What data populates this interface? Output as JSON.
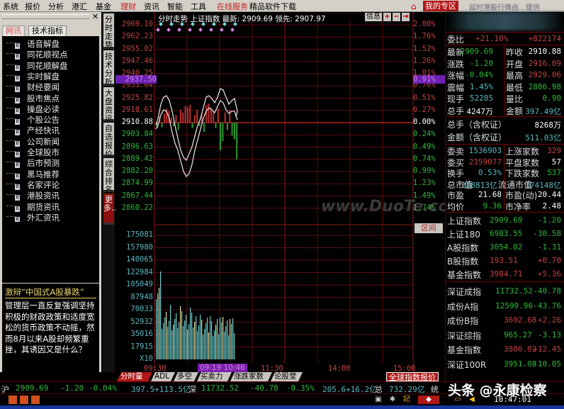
{
  "menu": [
    "系统",
    "报价",
    "分析",
    "港汇",
    "基金",
    "理财",
    "资讯",
    "智能",
    "工具",
    "在线服务",
    "精品软件下载"
  ],
  "header": {
    "my_zone": "我的专区",
    "hk_info": "延时港股行情由…提供"
  },
  "left": {
    "tabs": [
      "网讯",
      "技术指标"
    ],
    "tree": [
      "语音解盘",
      "同花顺视点",
      "同花顺解盘",
      "实时解盘",
      "财经要闻",
      "股市焦点",
      "操盘必读",
      "个股公告",
      "产经快讯",
      "公司新闻",
      "全球股市",
      "后市预测",
      "黑马推荐",
      "名家评论",
      "港股资讯",
      "期货资讯",
      "外汇资讯"
    ],
    "news_title": "激辩“中国式A股暴跌”",
    "news_body": "管理层一直反复强调坚持积极的财政政策和适度宽松的货币政策不动摇，然而8月以来A股却频繁重挫，其诱因又是什么？"
  },
  "vtabs": [
    "分时走势",
    "技术分析",
    "大盘资讯",
    "自选报价",
    "综合排名",
    "更多..."
  ],
  "chart": {
    "header": "分时走势  上证指数 最新: 2909.69 领先: 2907.97",
    "info_btn": "信息",
    "price_up": [
      "2969.10",
      "2962.23",
      "2955.02",
      "2947.46",
      "2940.25",
      "2933.04",
      "2925.82",
      "2918.61"
    ],
    "price_mid": "2910.88",
    "price_dn": [
      "2903.84",
      "2896.63",
      "2889.42",
      "2882.20",
      "2874.99",
      "2867.44",
      "2860.22"
    ],
    "price_sel": "2937.50",
    "pct_up": [
      "2.00%",
      "1.76%",
      "1.52%",
      "1.26%",
      "1.01%",
      "0.76%",
      "0.51%",
      "0.27%"
    ],
    "pct_mid": "0.00%",
    "pct_dn": [
      "0.24%",
      "0.49%",
      "0.74%",
      "0.99%",
      "1.23%",
      "1.49%",
      "1.74%"
    ],
    "pct_sel": "0.91%",
    "vol": [
      "175081",
      "157980",
      "140065",
      "122984",
      "105049",
      "87948",
      "70033",
      "52932",
      "35016",
      "17915",
      "X10"
    ],
    "times": [
      "09:30",
      "11:30",
      "14:00",
      "15:00"
    ],
    "time_sel": "09:19 10:46",
    "range_btn": "区间",
    "watermark": "www.DuoTe.com"
  },
  "bottom_tabs": [
    "分时量",
    "ADL",
    "多空",
    "买卖力道",
    "涨跌家数",
    "论股堂"
  ],
  "global_btn": "全球指数报价",
  "status": {
    "sh": "沪",
    "sh_price": "2909.69",
    "sh_chg": "-1.20",
    "sh_pct": "-0.04%",
    "sh_amt": "397.5+113.5亿",
    "sz": "深",
    "sz_price": "11732.52",
    "sz_chg": "-40.78",
    "sz_pct": "-0.35%",
    "sz_amt": "205.6+16.2亿",
    "total_lab": "总",
    "total": "732.29亿",
    "tong": "统",
    "clock": "10:47:01",
    "watermark": "头条 @永康检察"
  },
  "quote": {
    "weibi": [
      "委比",
      "+21.10%",
      "+822174"
    ],
    "rows": [
      [
        "最新",
        "2909.69",
        "昨收",
        "2910.88"
      ],
      [
        "涨跌",
        "-1.20",
        "开盘",
        "2916.09"
      ],
      [
        "涨幅",
        "-0.04%",
        "最高",
        "2929.06"
      ],
      [
        "震幅",
        "1.45%",
        "最低",
        "2886.98"
      ],
      [
        "现手",
        "52285",
        "量比",
        "0.90"
      ],
      [
        "总手",
        "4247万",
        "金额",
        "397.49亿"
      ]
    ],
    "zongshou_qz": [
      "总手（含权证）",
      "8268万"
    ],
    "jine_qz": [
      "金额（含权证）",
      "511.03亿"
    ],
    "rows2": [
      [
        "委卖",
        "1536903",
        "上涨家数",
        "329"
      ],
      [
        "委买",
        "2359077",
        "平盘家数",
        "57"
      ],
      [
        "换手",
        "0.53%",
        "下跌家数",
        "537"
      ],
      [
        "总市值",
        "188813亿",
        "流通市值",
        "174148亿"
      ],
      [
        "市盈",
        "21.68",
        "市盈(动)",
        "20.44"
      ],
      [
        "均价",
        "9.36",
        "市净率",
        "2.48"
      ]
    ],
    "indices_sh": [
      [
        "上证指数",
        "2909.69",
        "-1.20"
      ],
      [
        "上证180",
        "6983.55",
        "-30.58"
      ],
      [
        "A股指数",
        "3054.02",
        "-1.31"
      ],
      [
        "B股指数",
        "193.51",
        "+0.70"
      ],
      [
        "基金指数",
        "3984.71",
        "+5.36"
      ]
    ],
    "indices_sz": [
      [
        "深证成指",
        "11732.52",
        "-40.78"
      ],
      [
        "成份A指",
        "12590.96",
        "-43.76"
      ],
      [
        "成份B指",
        "3692.68",
        "+2.26"
      ],
      [
        "深证综指",
        "965.27",
        "-3.13"
      ],
      [
        "基金指数",
        "3806.02",
        "+12.45"
      ],
      [
        "深证100R",
        "3951.08",
        "-10.05"
      ]
    ]
  },
  "colors": {
    "up": "#c84040",
    "down": "#2fb83a",
    "accent": "#b01818"
  }
}
